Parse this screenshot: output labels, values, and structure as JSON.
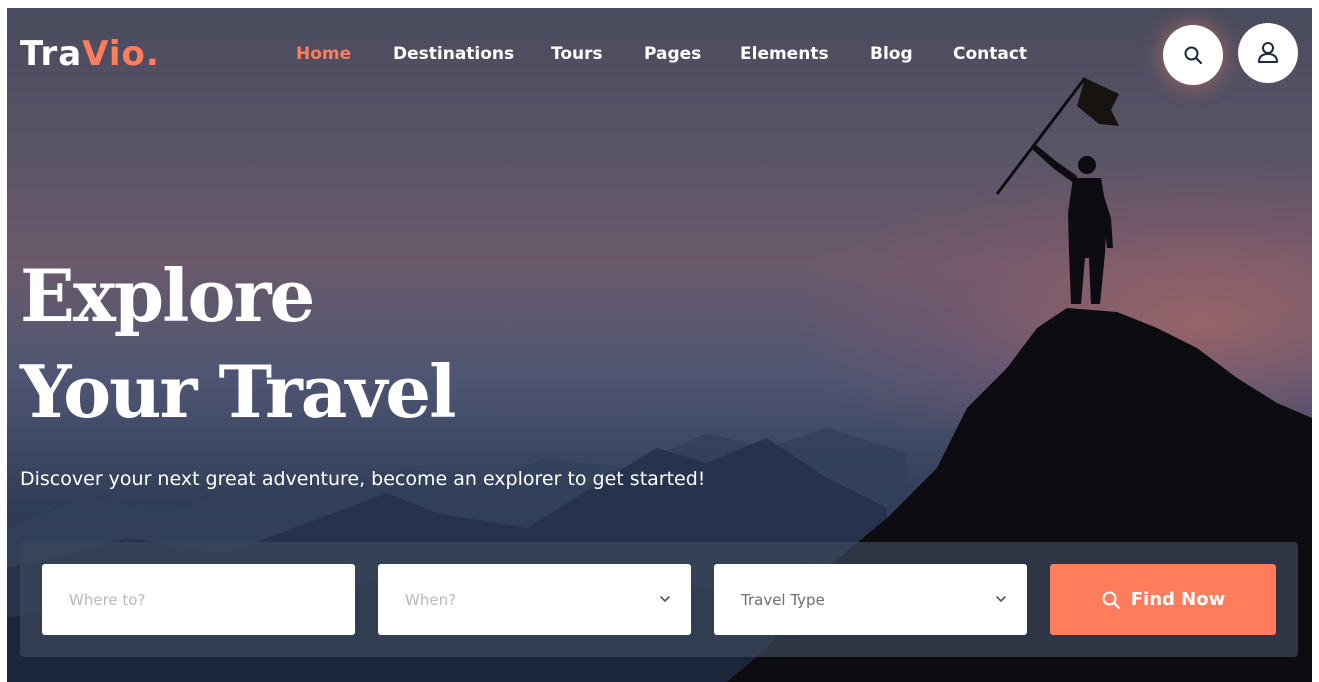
{
  "brand": {
    "logo_main": "Tra",
    "logo_accent": "Vio.",
    "accent_color": "#ff7c5c"
  },
  "nav": {
    "items": [
      {
        "label": "Home",
        "active": true
      },
      {
        "label": "Destinations",
        "active": false
      },
      {
        "label": "Tours",
        "active": false
      },
      {
        "label": "Pages",
        "active": false
      },
      {
        "label": "Elements",
        "active": false
      },
      {
        "label": "Blog",
        "active": false
      },
      {
        "label": "Contact",
        "active": false
      }
    ]
  },
  "header_actions": {
    "search_icon": "search-icon",
    "user_icon": "user-icon"
  },
  "hero": {
    "headline_line1": "Explore",
    "headline_line2": "Your Travel",
    "subtitle": "Discover your next great adventure, become an explorer to get started!"
  },
  "search_form": {
    "destination_placeholder": "Where to?",
    "date_placeholder": "When?",
    "travel_type_value": "Travel Type",
    "find_button_label": "Find Now",
    "find_button_icon": "search-icon"
  }
}
